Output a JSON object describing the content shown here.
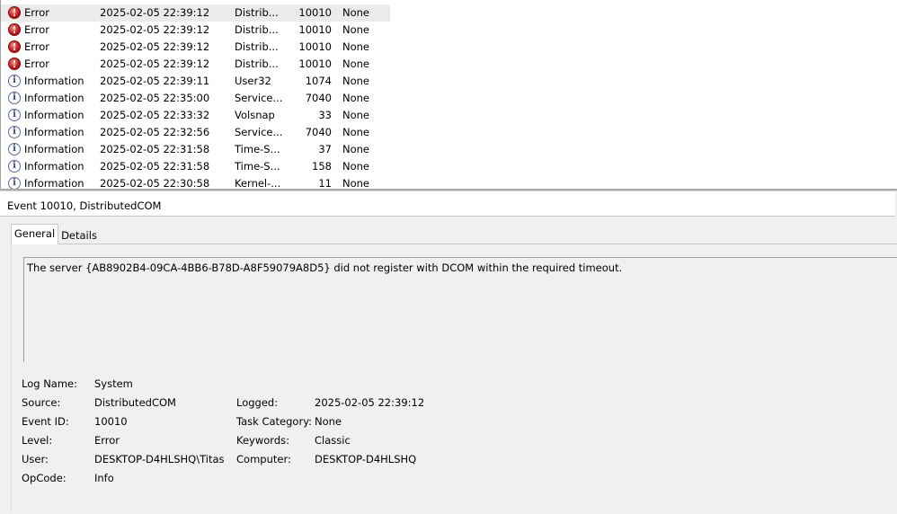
{
  "events": [
    {
      "icon": "error-icon",
      "level": "Error",
      "date": "2025-02-05 22:39:12",
      "source": "Distrib...",
      "id": "10010",
      "task": "None",
      "selected": true
    },
    {
      "icon": "error-icon",
      "level": "Error",
      "date": "2025-02-05 22:39:12",
      "source": "Distrib...",
      "id": "10010",
      "task": "None"
    },
    {
      "icon": "error-icon",
      "level": "Error",
      "date": "2025-02-05 22:39:12",
      "source": "Distrib...",
      "id": "10010",
      "task": "None"
    },
    {
      "icon": "error-icon",
      "level": "Error",
      "date": "2025-02-05 22:39:12",
      "source": "Distrib...",
      "id": "10010",
      "task": "None"
    },
    {
      "icon": "information-icon",
      "level": "Information",
      "date": "2025-02-05 22:39:11",
      "source": "User32",
      "id": "1074",
      "task": "None"
    },
    {
      "icon": "information-icon",
      "level": "Information",
      "date": "2025-02-05 22:35:00",
      "source": "Service...",
      "id": "7040",
      "task": "None"
    },
    {
      "icon": "information-icon",
      "level": "Information",
      "date": "2025-02-05 22:33:32",
      "source": "Volsnap",
      "id": "33",
      "task": "None"
    },
    {
      "icon": "information-icon",
      "level": "Information",
      "date": "2025-02-05 22:32:56",
      "source": "Service...",
      "id": "7040",
      "task": "None"
    },
    {
      "icon": "information-icon",
      "level": "Information",
      "date": "2025-02-05 22:31:58",
      "source": "Time-S...",
      "id": "37",
      "task": "None"
    },
    {
      "icon": "information-icon",
      "level": "Information",
      "date": "2025-02-05 22:31:58",
      "source": "Time-S...",
      "id": "158",
      "task": "None"
    },
    {
      "icon": "information-icon",
      "level": "Information",
      "date": "2025-02-05 22:30:58",
      "source": "Kernel-...",
      "id": "11",
      "task": "None"
    }
  ],
  "detail": {
    "header": "Event 10010, DistributedCOM",
    "tabs": {
      "general": "General",
      "details": "Details"
    },
    "description": "The server {AB8902B4-09CA-4BB6-B78D-A8F59079A8D5} did not register with DCOM within the required timeout.",
    "fields": {
      "log_name": {
        "label": "Log Name:",
        "value": "System"
      },
      "source": {
        "label": "Source:",
        "value": "DistributedCOM"
      },
      "event_id": {
        "label": "Event ID:",
        "value": "10010"
      },
      "level": {
        "label": "Level:",
        "value": "Error"
      },
      "user": {
        "label": "User:",
        "value": "DESKTOP-D4HLSHQ\\Titas"
      },
      "opcode": {
        "label": "OpCode:",
        "value": "Info"
      },
      "logged": {
        "label": "Logged:",
        "value": "2025-02-05 22:39:12"
      },
      "task_category": {
        "label": "Task Category:",
        "value": "None"
      },
      "keywords": {
        "label": "Keywords:",
        "value": "Classic"
      },
      "computer": {
        "label": "Computer:",
        "value": "DESKTOP-D4HLSHQ"
      }
    }
  },
  "colors": {
    "selected_row": "#ebebeb",
    "error": "#c0141a",
    "info": "#3a4a78",
    "pane_bg": "#f0f0f0"
  }
}
